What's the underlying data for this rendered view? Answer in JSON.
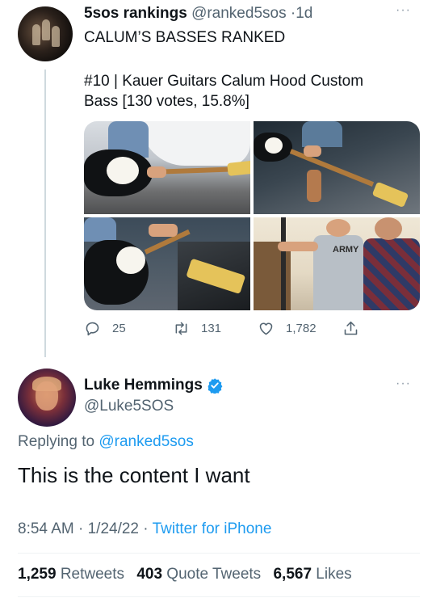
{
  "tweet": {
    "display_name": "5sos rankings",
    "handle": "@ranked5sos",
    "separator": "·",
    "time_ago": "1d",
    "more_icon": "···",
    "line1": "CALUM’S BASSES RANKED",
    "line2": "#10 | Kauer Guitars Calum Hood Custom",
    "line3": "Bass [130 votes, 15.8%]",
    "media_icons": [
      "guitar-photo",
      "guitar-photo",
      "guitar-photo",
      "people-photo"
    ],
    "shirt_text": "ARMY",
    "actions": {
      "reply_count": "25",
      "retweet_count": "131",
      "like_count": "1,782"
    }
  },
  "reply": {
    "display_name": "Luke Hemmings",
    "handle": "@Luke5SOS",
    "more_icon": "···",
    "replying_prefix": "Replying to",
    "replying_to": "@ranked5sos",
    "text": "This is the content I want",
    "time": "8:54 AM",
    "sep1": "·",
    "date": "1/24/22",
    "sep2": "·",
    "source": "Twitter for iPhone",
    "stats": {
      "retweets_num": "1,259",
      "retweets_label": "Retweets",
      "quotes_num": "403",
      "quotes_label": "Quote Tweets",
      "likes_num": "6,567",
      "likes_label": "Likes"
    }
  },
  "colors": {
    "accent": "#1d9bf0",
    "text": "#0f1419",
    "muted": "#536471"
  }
}
